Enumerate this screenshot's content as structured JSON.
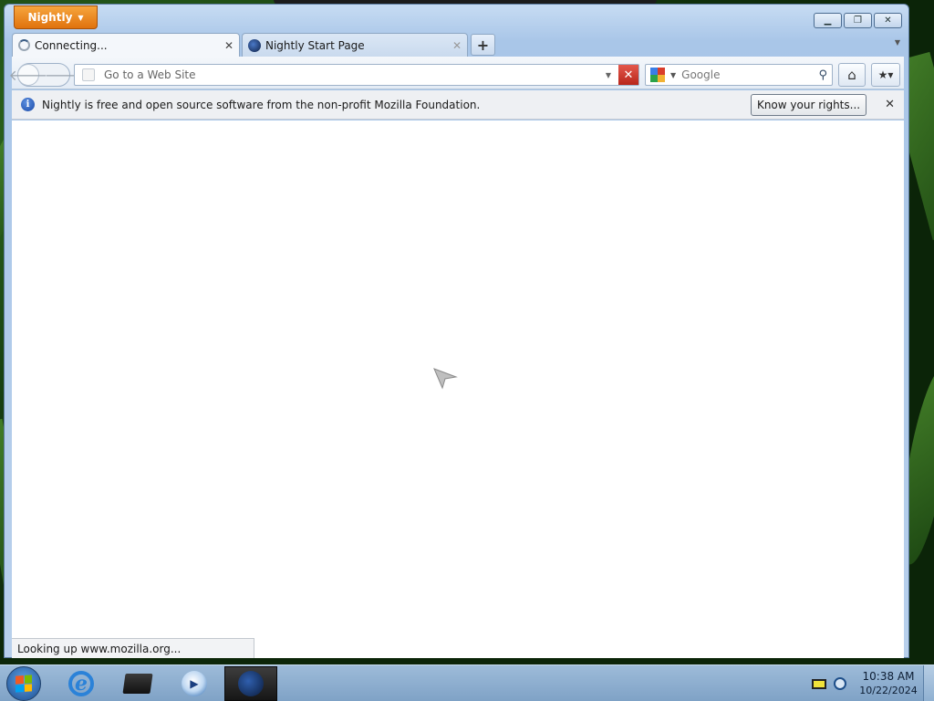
{
  "browser": {
    "app_menu_label": "Nightly",
    "tabs": [
      {
        "title": "Connecting...",
        "loading": true
      },
      {
        "title": "Nightly Start Page",
        "loading": false
      }
    ],
    "new_tab_label": "+",
    "url_placeholder": "Go to a Web Site",
    "search_engine": "Google",
    "notification": {
      "message": "Nightly is free and open source software from the non-profit Mozilla Foundation.",
      "button_label": "Know your rights..."
    },
    "status_text": "Looking up www.mozilla.org..."
  },
  "taskbar": {
    "clock_time": "10:38 AM",
    "clock_date": "10/22/2024"
  },
  "colors": {
    "app_button": "#e0720d",
    "stop_button": "#c8352a",
    "taskbar": "#8fb0d1"
  }
}
